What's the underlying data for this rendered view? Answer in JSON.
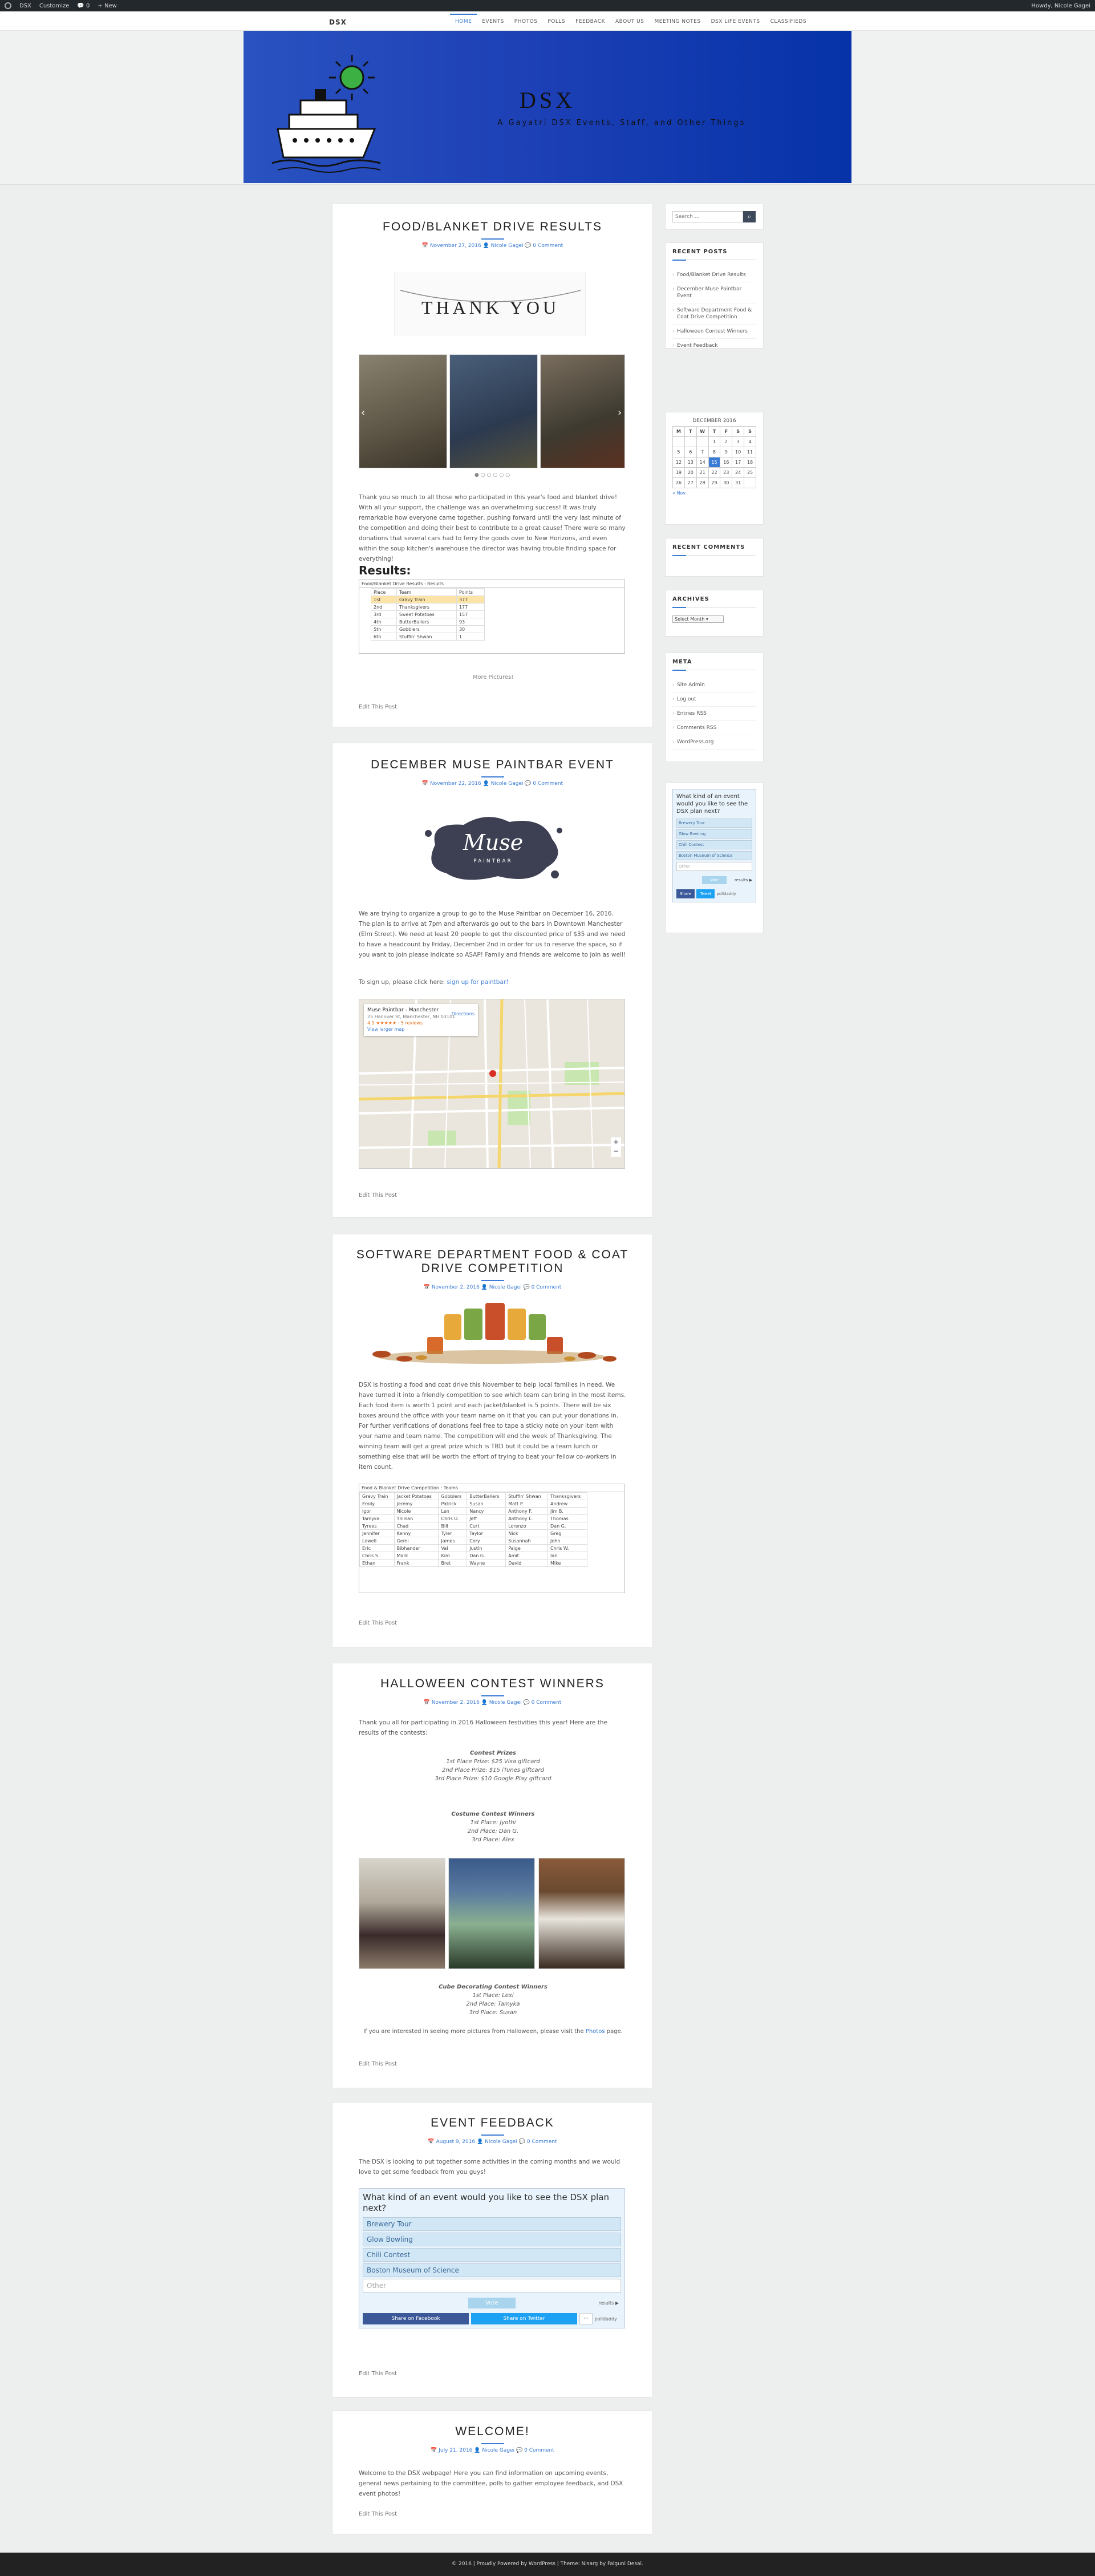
{
  "adminbar": {
    "site": "DSX",
    "customize": "Customize",
    "comments": "0",
    "new": "New",
    "greeting": "Howdy, Nicole Gagei"
  },
  "nav": {
    "site_title": "DSX",
    "menu": [
      "HOME",
      "EVENTS",
      "PHOTOS",
      "POLLS",
      "FEEDBACK",
      "ABOUT US",
      "MEETING NOTES",
      "DSX LIFE EVENTS",
      "CLASSIFIEDS"
    ]
  },
  "banner": {
    "title": "DSX",
    "subtitle": "A Gayatri DSX Events, Staff, and Other Things"
  },
  "posts": [
    {
      "title": "FOOD/BLANKET DRIVE RESULTS",
      "date": "November 27, 2016",
      "author": "Nicole Gagei",
      "comments": "0 Comment",
      "banner_text": "THANK YOU",
      "body": "Thank you so much to all those who participated in this year's food and blanket drive! With all your support, the challenge was an overwhelming success! It was truly remarkable how everyone came together, pushing forward until the very last minute of the competition and doing their best to contribute to a great cause! There were so many donations that several cars had to ferry the goods over to New Horizons, and even within the soup kitchen's warehouse the director was having trouble finding space for everything!",
      "results_heading": "Results:",
      "table_title": "Food/Blanket Drive Results : Results",
      "table_headers": [
        "Place",
        "Team",
        "Points"
      ],
      "table_rows": [
        [
          "1st",
          "Gravy Train",
          "377"
        ],
        [
          "2nd",
          "Thanksgivers",
          "177"
        ],
        [
          "3rd",
          "Sweet Potatoes",
          "157"
        ],
        [
          "4th",
          "ButterBallers",
          "93"
        ],
        [
          "5th",
          "Gobblers",
          "30"
        ],
        [
          "6th",
          "Stuffin' Shwan",
          "1"
        ]
      ],
      "more": "More Pictures!",
      "edit": "Edit This Post"
    },
    {
      "title": "DECEMBER MUSE PAINTBAR EVENT",
      "date": "November 22, 2016",
      "author": "Nicole Gagei",
      "comments": "0 Comment",
      "logo_text": "Muse",
      "logo_sub": "PAINTBAR",
      "body": "We are trying to organize a group to go to the Muse Paintbar on December 16, 2016. The plan is to arrive at 7pm and afterwards go out to the bars in Downtown Manchester (Elm Street). We need at least 20 people to get the discounted price of $35 and we need to have a headcount by Friday, December 2nd in order for us to reserve the space, so if you want to join please indicate so ASAP! Family and friends are welcome to join as well!",
      "signup_prefix": "To sign up, please click here:",
      "signup_link": "sign up for paintbar!",
      "map_place": "Muse Paintbar - Manchester",
      "map_addr": "25 Hanover St, Manchester, NH 03101",
      "map_rating": "4.9 ★★★★★ · 5 reviews",
      "map_larger": "View larger map",
      "map_directions": "Directions",
      "edit": "Edit This Post"
    },
    {
      "title": "SOFTWARE DEPARTMENT FOOD & COAT DRIVE COMPETITION",
      "date": "November 2, 2016",
      "author": "Nicole Gagei",
      "comments": "0 Comment",
      "body": "DSX is hosting a food and coat drive this November to help local families in need. We have turned it into a friendly competition to see which team can bring in the most items. Each food item is worth 1 point and each jacket/blanket is 5 points. There will be six boxes around the office with your team name on it that you can put your donations in. For further verifications of donations feel free to tape a sticky note on your item with your name and team name. The competition will end the week of Thanksgiving. The winning team will get a great prize which is TBD but it could be a team lunch or something else that will be worth the effort of trying to beat your fellow co-workers in item count.",
      "table_title": "Food & Blanket Drive Competition : Teams",
      "table_headers": [
        "Gravy Train",
        "Jacket Potatoes",
        "Gobblers",
        "ButterBallers",
        "Stuffin' Shwan",
        "Thanksgivers"
      ],
      "table_rows": [
        [
          "Emily",
          "Jeremy",
          "Patrick",
          "Susan",
          "Matt P.",
          "Andrew"
        ],
        [
          "Igor",
          "Nicole",
          "Len",
          "Nancy",
          "Anthony F.",
          "Jim B."
        ],
        [
          "Tamyka",
          "Thilsan",
          "Chris U.",
          "Jeff",
          "Anthony L.",
          "Thomas"
        ],
        [
          "Tyrees",
          "Chad",
          "Bill",
          "Curt",
          "Lorenzo",
          "Dan G."
        ],
        [
          "Jennifer",
          "Kenny",
          "Tyler",
          "Taylor",
          "Nick",
          "Greg"
        ],
        [
          "Lowell",
          "Gemi",
          "James",
          "Cory",
          "Susannah",
          "John"
        ],
        [
          "Eric",
          "Bibhander",
          "Val",
          "Justin",
          "Paige",
          "Chris W."
        ],
        [
          "Chris S.",
          "Mark",
          "Kim",
          "Dan G.",
          "Amit",
          "Ian"
        ],
        [
          "Ethan",
          "Frank",
          "Bret",
          "Wayne",
          "David",
          "Mike"
        ]
      ],
      "edit": "Edit This Post"
    },
    {
      "title": "HALLOWEEN CONTEST WINNERS",
      "date": "November 2, 2016",
      "author": "Nicole Gagei",
      "comments": "0 Comment",
      "intro": "Thank you all for participating in 2016 Halloween festivities this year! Here are the results of the contests:",
      "contest_title": "Contest Prizes",
      "contest": [
        "1st Place Prize: $25 Visa giftcard",
        "2nd Place Prize: $15 iTunes giftcard",
        "3rd Place Prize: $10 Google Play giftcard"
      ],
      "costume_title": "Costume Contest Winners",
      "costume": [
        "1st Place: Jyothi",
        "2nd Place: Dan G.",
        "3rd Place: Alex"
      ],
      "cube_title": "Cube Decorating Contest Winners",
      "cube": [
        "1st Place: Lexi",
        "2nd Place: Tamyka",
        "3rd Place: Susan"
      ],
      "outro_prefix": "If you are interested in seeing more pictures from Halloween, please visit the",
      "outro_link": "Photos",
      "outro_suffix": "page.",
      "edit": "Edit This Post"
    },
    {
      "title": "EVENT FEEDBACK",
      "date": "August 9, 2016",
      "author": "Nicole Gagei",
      "comments": "0 Comment",
      "body": "The DSX is looking to put together some activities in the coming months and we would love to get some feedback from you guys!",
      "poll_q": "What kind of an event would you like to see the DSX plan next?",
      "poll_opts": [
        "Brewery Tour",
        "Glow Bowling",
        "Chili Contest",
        "Boston Museum of Science"
      ],
      "poll_other": "Other",
      "poll_vote": "Vote",
      "poll_results": "results ▶",
      "share_fb": "Share on Facebook",
      "share_tw": "Share on Twitter",
      "share_more": "···",
      "poll_badge": "polldaddy",
      "edit": "Edit This Post"
    },
    {
      "title": "WELCOME!",
      "date": "July 21, 2016",
      "author": "Nicole Gagei",
      "comments": "0 Comment",
      "body": "Welcome to the DSX webpage! Here you can find information on upcoming events, general news pertaining to the committee, polls to gather employee feedback, and DSX event photos!",
      "edit": "Edit This Post"
    }
  ],
  "sidebar": {
    "search_placeholder": "Search ...",
    "recent_posts_title": "RECENT POSTS",
    "recent_posts": [
      "Food/Blanket Drive Results",
      "December Muse Paintbar Event",
      "Software Department Food & Coat Drive Competition",
      "Halloween Contest Winners",
      "Event Feedback"
    ],
    "calendar_title": "DECEMBER 2016",
    "calendar_head": [
      "M",
      "T",
      "W",
      "T",
      "F",
      "S",
      "S"
    ],
    "calendar_rows": [
      [
        "",
        "",
        "",
        "1",
        "2",
        "3",
        "4"
      ],
      [
        "5",
        "6",
        "7",
        "8",
        "9",
        "10",
        "11"
      ],
      [
        "12",
        "13",
        "14",
        "15",
        "16",
        "17",
        "18"
      ],
      [
        "19",
        "20",
        "21",
        "22",
        "23",
        "24",
        "25"
      ],
      [
        "26",
        "27",
        "28",
        "29",
        "30",
        "31",
        ""
      ]
    ],
    "calendar_today": "15",
    "calendar_prev": "« Nov",
    "recent_comments_title": "RECENT COMMENTS",
    "archives_title": "ARCHIVES",
    "archives_select": "Select Month",
    "meta_title": "META",
    "meta": [
      "Site Admin",
      "Log out",
      "Entries RSS",
      "Comments RSS",
      "WordPress.org"
    ],
    "poll_q": "What kind of an event would you like to see the DSX plan next?",
    "poll_opts": [
      "Brewery Tour",
      "Glow Bowling",
      "Chili Contest",
      "Boston Museum of Science",
      "Other"
    ],
    "poll_vote": "Vote",
    "poll_results": "results ▶",
    "share_fb": "Share",
    "share_tw": "Tweet",
    "poll_badge": "polldaddy"
  },
  "footer": "© 2016 | Proudly Powered by WordPress | Theme: Nisarg by Falguni Desai."
}
